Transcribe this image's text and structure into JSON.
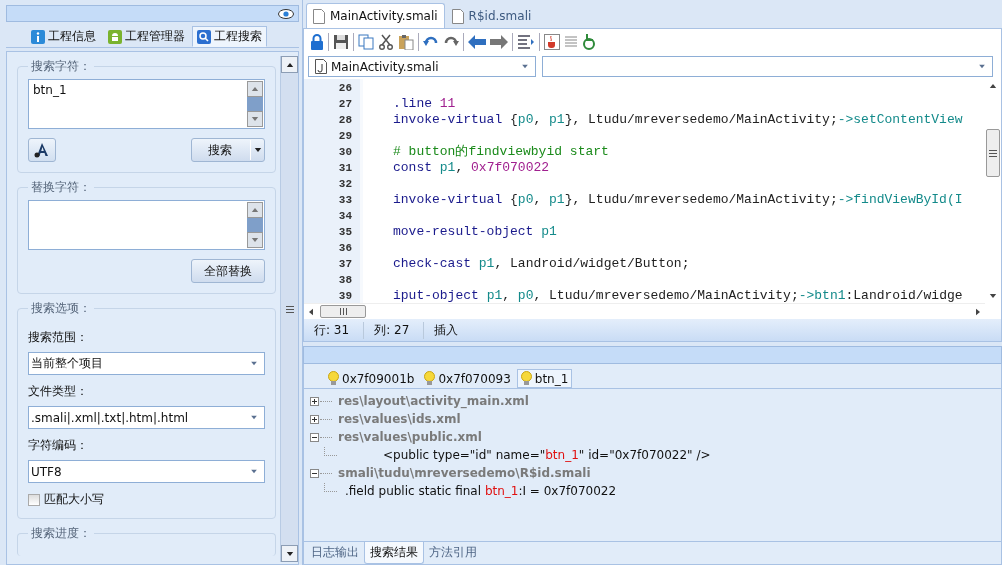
{
  "left_panel": {
    "tabs": [
      {
        "label": "工程信息",
        "selected": false
      },
      {
        "label": "工程管理器",
        "selected": false
      },
      {
        "label": "工程搜索",
        "selected": true
      }
    ],
    "search_group": {
      "title": "搜索字符：",
      "value": "btn_1",
      "search_button": "搜索"
    },
    "replace_group": {
      "title": "替换字符：",
      "replace_all_button": "全部替换"
    },
    "options_group": {
      "title": "搜索选项：",
      "scope_label": "搜索范围：",
      "scope": "当前整个项目",
      "type_label": "文件类型：",
      "types": ".smali|.xml|.txt|.htm|.html",
      "encoding_label": "字符编码：",
      "encoding": "UTF8",
      "match_case": {
        "label": "匹配大小写",
        "checked": false
      }
    },
    "progress_group": {
      "title": "搜索进度："
    }
  },
  "editor": {
    "tabs": [
      {
        "label": "MainActivity.smali",
        "selected": true
      },
      {
        "label": "R$id.smali",
        "selected": false
      }
    ],
    "file_select": "MainActivity.smali",
    "lines": [
      {
        "number": "26"
      },
      {
        "number": "27",
        "tokens": [
          {
            "kind": "kw",
            "text": ".line"
          },
          {
            "kind": "num",
            "text": " 11"
          }
        ]
      },
      {
        "number": "28",
        "tokens": [
          {
            "kind": "kw",
            "text": "invoke-virtual"
          },
          {
            "kind": "plain",
            "text": " {"
          },
          {
            "kind": "reg",
            "text": "p0"
          },
          {
            "kind": "plain",
            "text": ", "
          },
          {
            "kind": "reg",
            "text": "p1"
          },
          {
            "kind": "plain",
            "text": "}, Ltudu/mreversedemo/MainActivity;"
          },
          {
            "kind": "method",
            "text": "->setContentView"
          }
        ]
      },
      {
        "number": "29"
      },
      {
        "number": "30",
        "tokens": [
          {
            "kind": "comment",
            "text": "# button的findviewbyid  start"
          }
        ]
      },
      {
        "number": "31",
        "tokens": [
          {
            "kind": "kw",
            "text": "const"
          },
          {
            "kind": "reg",
            "text": " p1"
          },
          {
            "kind": "plain",
            "text": ", "
          },
          {
            "kind": "num",
            "text": "0x7f070022"
          }
        ]
      },
      {
        "number": "32"
      },
      {
        "number": "33",
        "tokens": [
          {
            "kind": "kw",
            "text": "invoke-virtual"
          },
          {
            "kind": "plain",
            "text": " {"
          },
          {
            "kind": "reg",
            "text": "p0"
          },
          {
            "kind": "plain",
            "text": ", "
          },
          {
            "kind": "reg",
            "text": "p1"
          },
          {
            "kind": "plain",
            "text": "}, Ltudu/mreversedemo/MainActivity;"
          },
          {
            "kind": "method",
            "text": "->findViewById(I"
          }
        ]
      },
      {
        "number": "34"
      },
      {
        "number": "35",
        "tokens": [
          {
            "kind": "kw",
            "text": "move-result-object"
          },
          {
            "kind": "reg",
            "text": " p1"
          }
        ]
      },
      {
        "number": "36"
      },
      {
        "number": "37",
        "tokens": [
          {
            "kind": "kw",
            "text": "check-cast"
          },
          {
            "kind": "reg",
            "text": " p1"
          },
          {
            "kind": "plain",
            "text": ", Landroid/widget/Button;"
          }
        ]
      },
      {
        "number": "38"
      },
      {
        "number": "39",
        "tokens": [
          {
            "kind": "kw",
            "text": "iput-object"
          },
          {
            "kind": "reg",
            "text": " p1"
          },
          {
            "kind": "plain",
            "text": ", "
          },
          {
            "kind": "reg",
            "text": "p0"
          },
          {
            "kind": "plain",
            "text": ", Ltudu/mreversedemo/MainActivity;"
          },
          {
            "kind": "method",
            "text": "->btn1"
          },
          {
            "kind": "plain",
            "text": ":Landroid/widge"
          }
        ]
      }
    ],
    "status": {
      "row": "行: 31",
      "col": "列: 27",
      "mode": "插入"
    }
  },
  "results": {
    "tabs": [
      {
        "label": "0x7f09001b",
        "selected": false
      },
      {
        "label": "0x7f070093",
        "selected": false
      },
      {
        "label": "btn_1",
        "selected": true
      }
    ],
    "tree": [
      {
        "label": "res\\layout\\activity_main.xml",
        "expanded": false
      },
      {
        "label": "res\\values\\ids.xml",
        "expanded": false
      },
      {
        "label": "res\\values\\public.xml",
        "expanded": true,
        "children": [
          {
            "parts": [
              {
                "text": "<public type=\"id\" name=\"",
                "match": false
              },
              {
                "text": "btn_1",
                "match": true
              },
              {
                "text": "\" id=\"0x7f070022\" />",
                "match": false
              }
            ]
          }
        ]
      },
      {
        "label": "smali\\tudu\\mreversedemo\\R$id.smali",
        "expanded": true,
        "children": [
          {
            "parts": [
              {
                "text": ".field public static final ",
                "match": false
              },
              {
                "text": "btn_1",
                "match": true
              },
              {
                "text": ":I = 0x7f070022",
                "match": false
              }
            ]
          }
        ]
      }
    ],
    "bottom_tabs": [
      {
        "label": "日志输出",
        "selected": false
      },
      {
        "label": "搜索结果",
        "selected": true
      },
      {
        "label": "方法引用",
        "selected": false
      }
    ]
  }
}
